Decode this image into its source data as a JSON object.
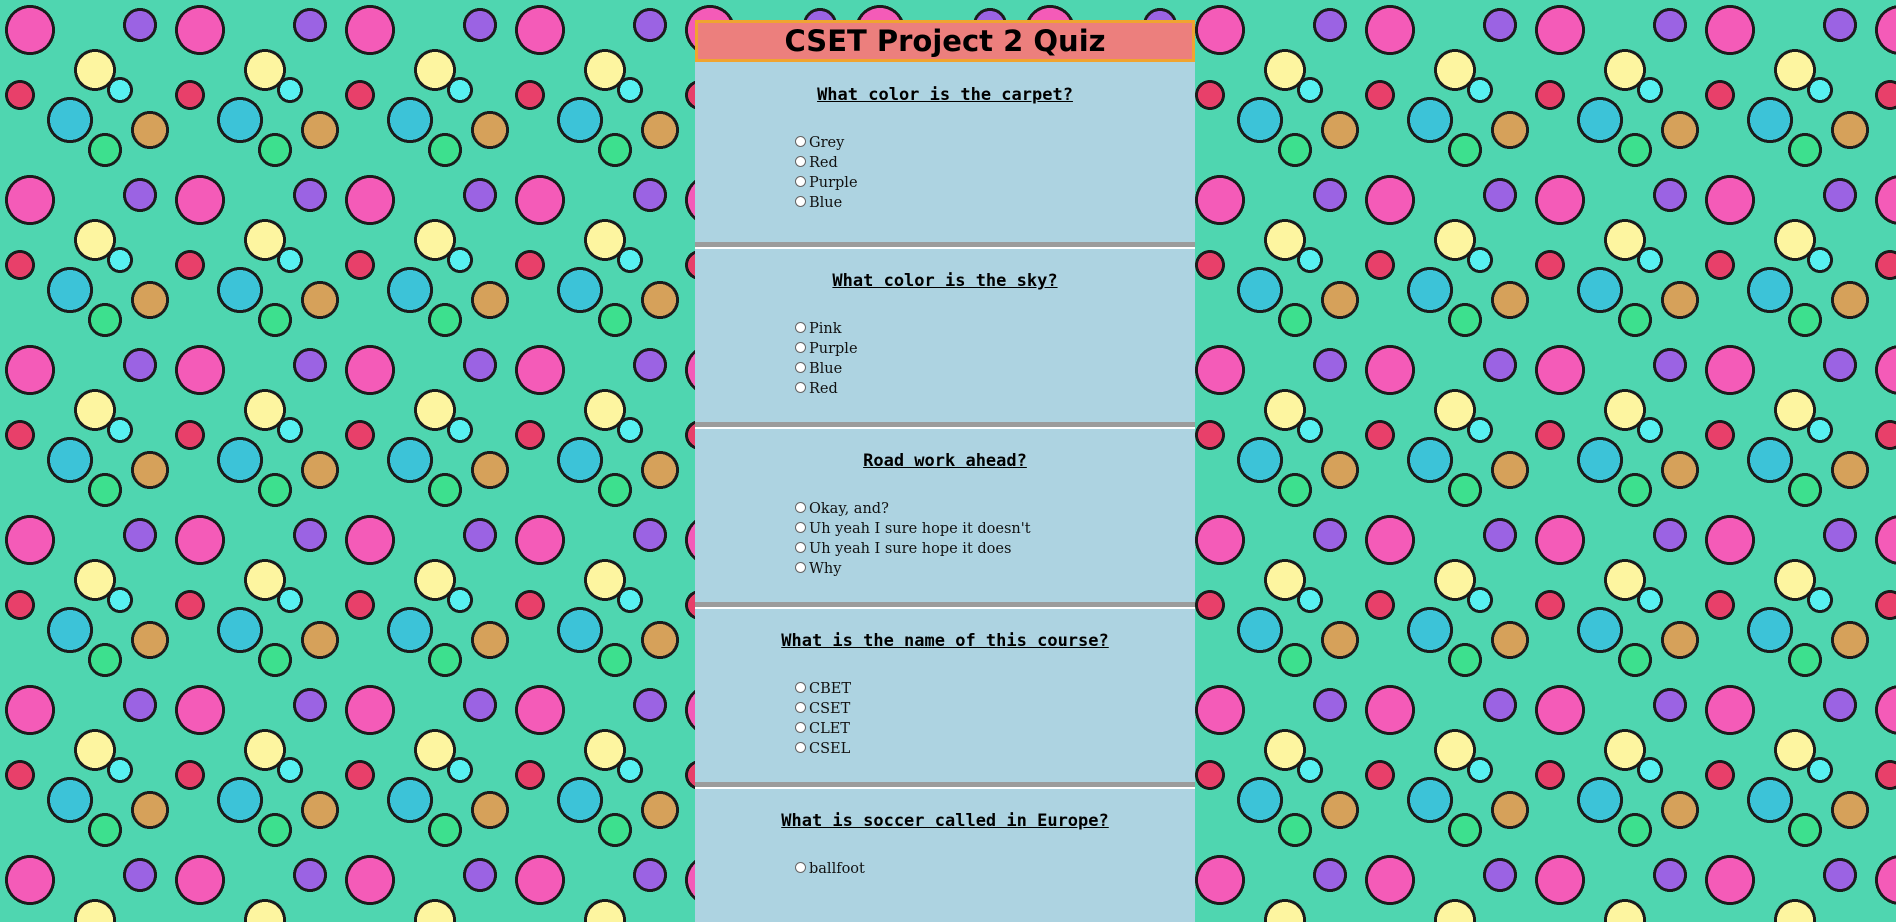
{
  "quiz": {
    "title": "CSET Project 2 Quiz",
    "questions": [
      {
        "text": "What color is the carpet?",
        "options": [
          "Grey",
          "Red",
          "Purple",
          "Blue"
        ]
      },
      {
        "text": "What color is the sky?",
        "options": [
          "Pink",
          "Purple",
          "Blue",
          "Red"
        ]
      },
      {
        "text": "Road work ahead?",
        "options": [
          "Okay, and?",
          "Uh yeah I sure hope it doesn't",
          "Uh yeah I sure hope it does",
          "Why"
        ]
      },
      {
        "text": "What is the name of this course?",
        "options": [
          "CBET",
          "CSET",
          "CLET",
          "CSEL"
        ]
      },
      {
        "text": "What is soccer called in Europe?",
        "options": [
          "ballfoot"
        ]
      }
    ]
  },
  "colors": {
    "title_bar": "#ec7f7d",
    "title_border": "#f0a430",
    "question_panel": "#add3e1",
    "divider": "#9c9c9c"
  }
}
